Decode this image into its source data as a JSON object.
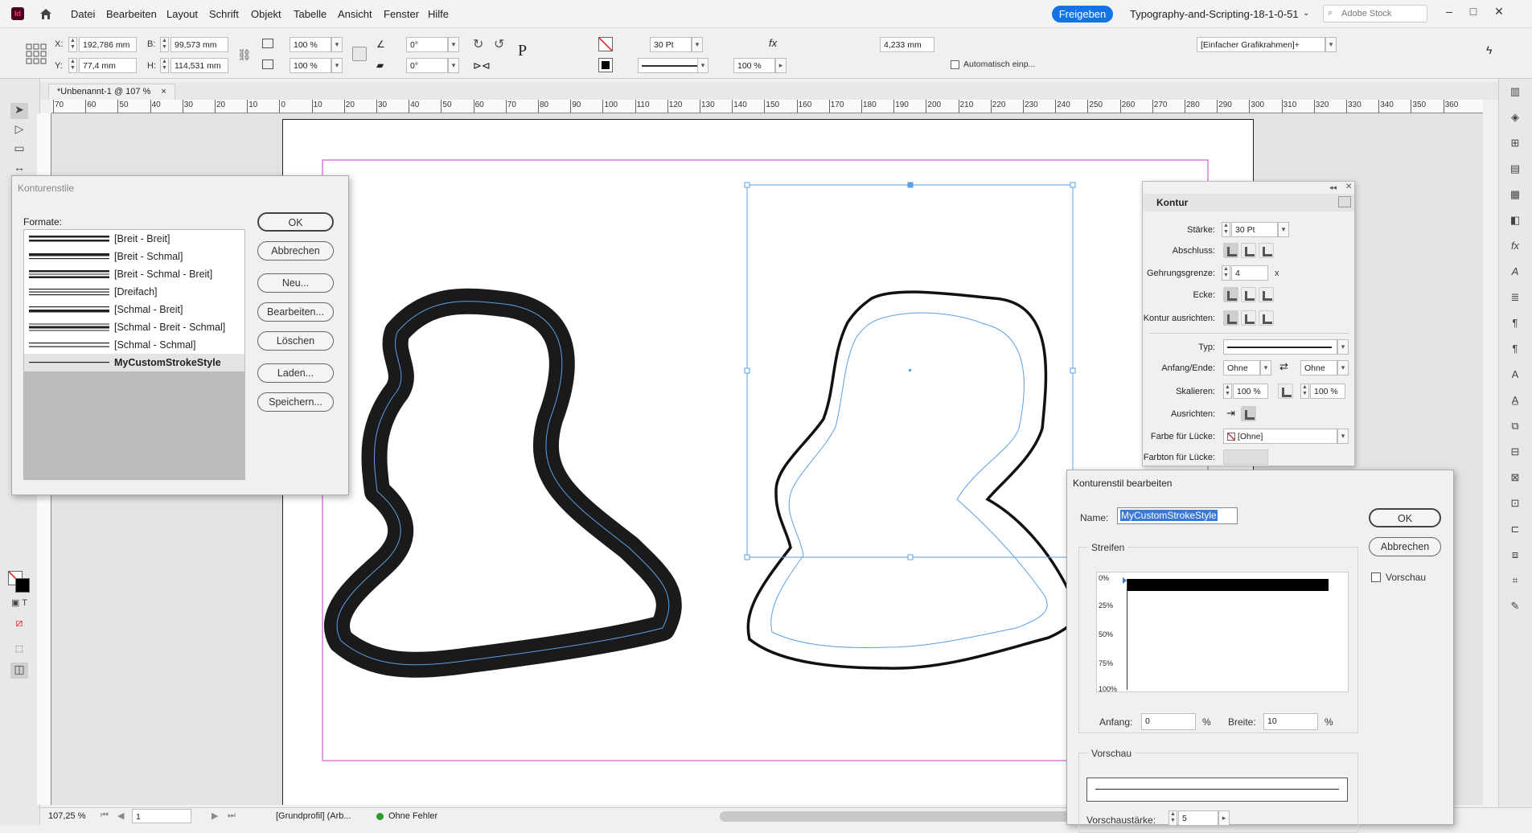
{
  "app": {
    "icon": "Id",
    "menus": [
      "Datei",
      "Bearbeiten",
      "Layout",
      "Schrift",
      "Objekt",
      "Tabelle",
      "Ansicht",
      "Fenster",
      "Hilfe"
    ],
    "share_label": "Freigeben",
    "doc_title": "Typography-and-Scripting-18-1-0-51",
    "search_placeholder": "Adobe Stock"
  },
  "control": {
    "x_label": "X:",
    "x_value": "192,786 mm",
    "y_label": "Y:",
    "y_value": "77,4 mm",
    "w_label": "B:",
    "w_value": "99,573 mm",
    "h_label": "H:",
    "h_value": "114,531 mm",
    "scale_x": "100 %",
    "scale_y": "100 %",
    "rot": "0°",
    "shear": "0°",
    "stroke_weight": "30 Pt",
    "opacity": "100 %",
    "offset": "4,233 mm",
    "auto_fit": "Automatisch einp...",
    "object_style": "[Einfacher Grafikrahmen]+"
  },
  "tab": {
    "title": "*Unbenannt-1 @ 107 %",
    "close": "×"
  },
  "ruler": {
    "labels": [
      "70",
      "60",
      "50",
      "40",
      "30",
      "20",
      "10",
      "0",
      "10",
      "20",
      "30",
      "40",
      "50",
      "60",
      "70",
      "80",
      "90",
      "100",
      "110",
      "120",
      "130",
      "140",
      "150",
      "160",
      "170",
      "180",
      "190",
      "200",
      "210",
      "220",
      "230",
      "240",
      "250",
      "260",
      "270",
      "280",
      "290",
      "300",
      "310",
      "320",
      "330",
      "340",
      "350",
      "360"
    ]
  },
  "konturstile": {
    "title": "Konturenstile",
    "formats_label": "Formate:",
    "styles": [
      {
        "name": "[Breit - Breit]",
        "pattern": "thick-thick"
      },
      {
        "name": "[Breit - Schmal]",
        "pattern": "thick-thin"
      },
      {
        "name": "[Breit - Schmal - Breit]",
        "pattern": "thick-thin-thick"
      },
      {
        "name": "[Dreifach]",
        "pattern": "triple"
      },
      {
        "name": "[Schmal - Breit]",
        "pattern": "thin-thick"
      },
      {
        "name": "[Schmal - Breit - Schmal]",
        "pattern": "thin-thick-thin"
      },
      {
        "name": "[Schmal - Schmal]",
        "pattern": "thin-thin"
      },
      {
        "name": "MyCustomStrokeStyle",
        "pattern": "single-thin",
        "selected": true
      }
    ],
    "buttons": [
      "OK",
      "Abbrechen",
      "Neu...",
      "Bearbeiten...",
      "Löschen",
      "Laden...",
      "Speichern..."
    ]
  },
  "kontur": {
    "title": "Kontur",
    "staerke_label": "Stärke:",
    "staerke_value": "30 Pt",
    "abschluss_label": "Abschluss:",
    "gehrung_label": "Gehrungsgrenze:",
    "gehrung_value": "4",
    "gehrung_unit": "x",
    "ecke_label": "Ecke:",
    "ausrichten_label": "Kontur ausrichten:",
    "typ_label": "Typ:",
    "anfang_label": "Anfang/Ende:",
    "anfang_value": "Ohne",
    "ende_value": "Ohne",
    "skalieren_label": "Skalieren:",
    "skal_a": "100 %",
    "skal_b": "100 %",
    "ausrichten2_label": "Ausrichten:",
    "luecke_label": "Farbe für Lücke:",
    "luecke_value": "[Ohne]",
    "farbton_label": "Farbton für Lücke:"
  },
  "edit": {
    "title": "Konturenstil bearbeiten",
    "name_label": "Name:",
    "name_value": "MyCustomStrokeStyle",
    "ok": "OK",
    "cancel": "Abbrechen",
    "preview_check": "Vorschau",
    "streifen_label": "Streifen",
    "ticks": [
      "0%",
      "25%",
      "50%",
      "75%",
      "100%"
    ],
    "stripe": {
      "start": 0,
      "width": 10
    },
    "anfang_label": "Anfang:",
    "anfang_value": "0",
    "pct1": "%",
    "breite_label": "Breite:",
    "breite_value": "10",
    "pct2": "%",
    "vorschau_label": "Vorschau",
    "vs_label": "Vorschaustärke:",
    "vs_value": "5"
  },
  "status": {
    "zoom": "107,25 %",
    "page": "1",
    "profile": "[Grundprofil] (Arb...",
    "errors": "Ohne Fehler",
    "ok_color": "#2a9d2a"
  }
}
